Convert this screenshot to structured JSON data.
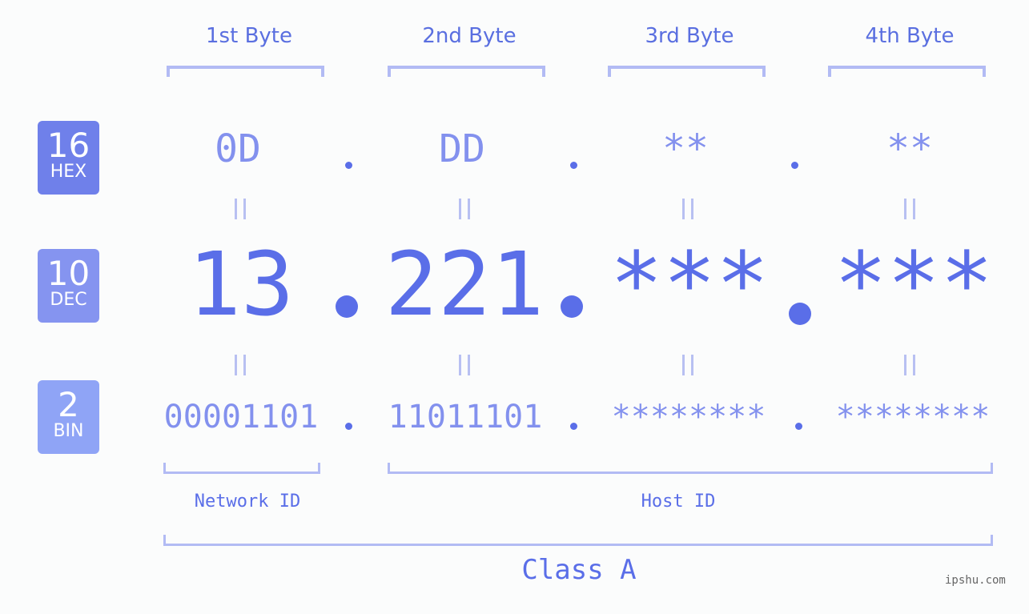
{
  "headers": [
    "1st Byte",
    "2nd Byte",
    "3rd Byte",
    "4th Byte"
  ],
  "badges": {
    "hex": {
      "num": "16",
      "label": "HEX",
      "color": "#6f80ea"
    },
    "dec": {
      "num": "10",
      "label": "DEC",
      "color": "#8594f0"
    },
    "bin": {
      "num": "2",
      "label": "BIN",
      "color": "#8fa4f6"
    }
  },
  "hex": [
    "0D",
    "DD",
    "**",
    "**"
  ],
  "dec": [
    "13",
    "221",
    "***",
    "***"
  ],
  "bin": [
    "00001101",
    "11011101",
    "********",
    "********"
  ],
  "ids": {
    "network": "Network ID",
    "host": "Host ID"
  },
  "class_label": "Class A",
  "watermark": "ipshu.com",
  "colors": {
    "accent": "#5a6ee8",
    "light": "#8391ee",
    "bracket": "#b2bbf4"
  }
}
